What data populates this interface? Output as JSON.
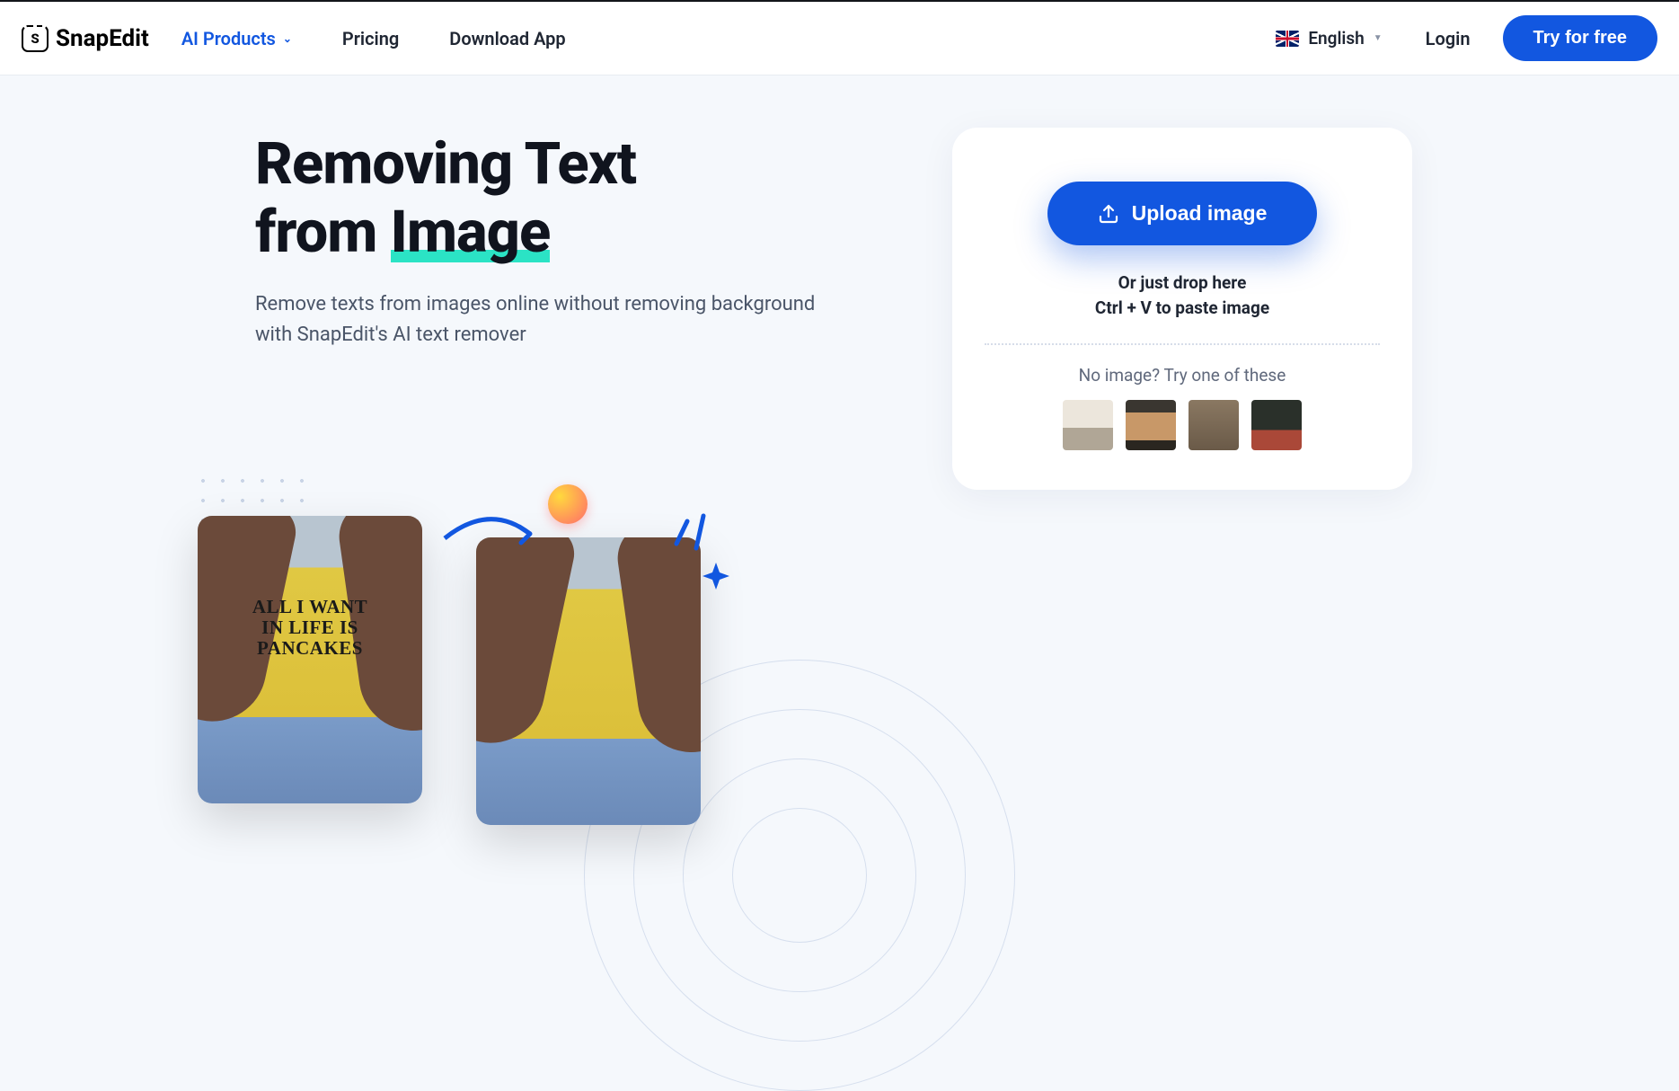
{
  "brand": "SnapEdit",
  "nav": {
    "ai_products": "AI Products",
    "pricing": "Pricing",
    "download_app": "Download App"
  },
  "language": {
    "label": "English"
  },
  "auth": {
    "login": "Login",
    "try_free": "Try for free"
  },
  "hero": {
    "title_line1": "Removing Text",
    "title_line2_prefix": "from ",
    "title_line2_highlight": "Image",
    "subtitle": "Remove texts from images online without removing background with SnapEdit's AI text remover"
  },
  "demo": {
    "shirt_text": "ALL I WANT IN LIFE IS PANCAKES"
  },
  "upload": {
    "button": "Upload image",
    "drop_line1": "Or just drop here",
    "drop_line2": "Ctrl + V to paste image",
    "samples_label": "No image? Try one of these"
  }
}
